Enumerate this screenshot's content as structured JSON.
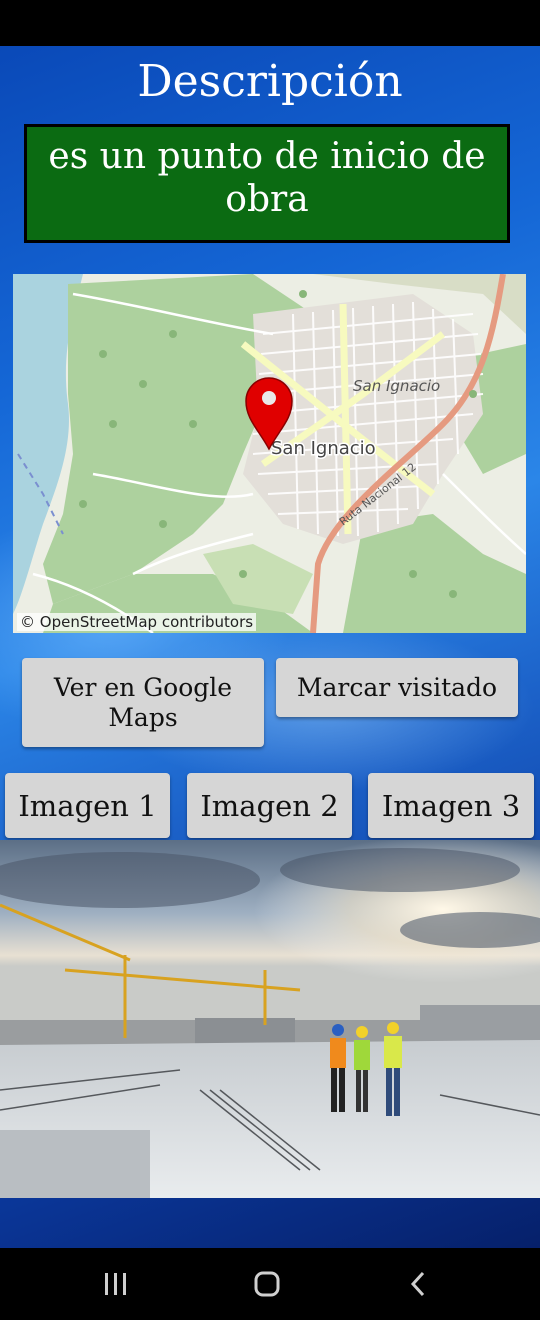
{
  "title": "Descripción",
  "description": "es un punto de inicio de obra",
  "map": {
    "place_label": "San Ignacio",
    "place_label_small": "San Ignacio",
    "road_label": "Ruta Nacional 12",
    "attribution": "© OpenStreetMap contributors",
    "marker_color": "#e00000"
  },
  "buttons": {
    "google_maps": "Ver en Google Maps",
    "mark_visited": "Marcar visitado"
  },
  "image_buttons": [
    "Imagen 1",
    "Imagen 2",
    "Imagen 3"
  ],
  "photo": {
    "subject": "construction-site-photo"
  },
  "nav": {
    "recent": "recent-apps-icon",
    "home": "home-icon",
    "back": "back-icon"
  },
  "colors": {
    "description_bg": "#0b6b12",
    "button_bg": "#d6d6d6",
    "app_bg": "#1567d6"
  }
}
